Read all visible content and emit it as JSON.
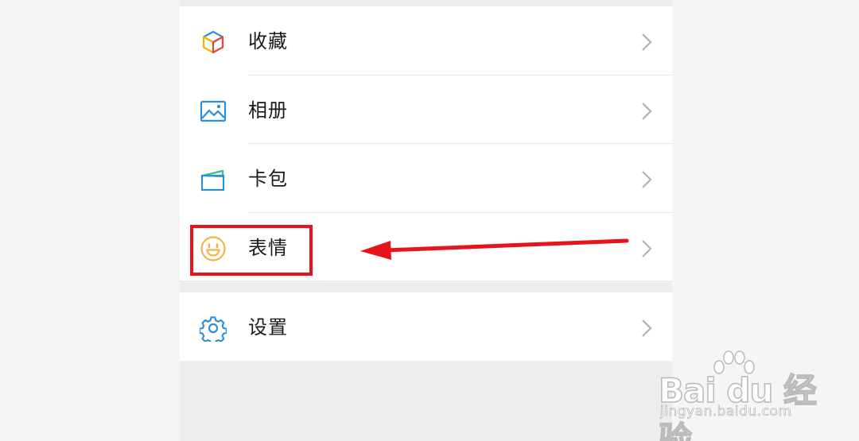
{
  "menu": {
    "items": [
      {
        "label": "收藏",
        "icon": "favorites-cube-icon"
      },
      {
        "label": "相册",
        "icon": "album-picture-icon"
      },
      {
        "label": "卡包",
        "icon": "card-wallet-icon"
      },
      {
        "label": "表情",
        "icon": "sticker-smiley-icon"
      }
    ],
    "settings": {
      "label": "设置",
      "icon": "settings-gear-icon"
    }
  },
  "annotation": {
    "highlight_color": "#e8141b",
    "target": "表情"
  },
  "watermark": {
    "brand": "Bai du 经验",
    "url": "jingyan.baidu.com"
  },
  "colors": {
    "background": "#ededed",
    "row": "#ffffff",
    "text": "#1a1a1a",
    "chevron": "#b3b3b3"
  }
}
